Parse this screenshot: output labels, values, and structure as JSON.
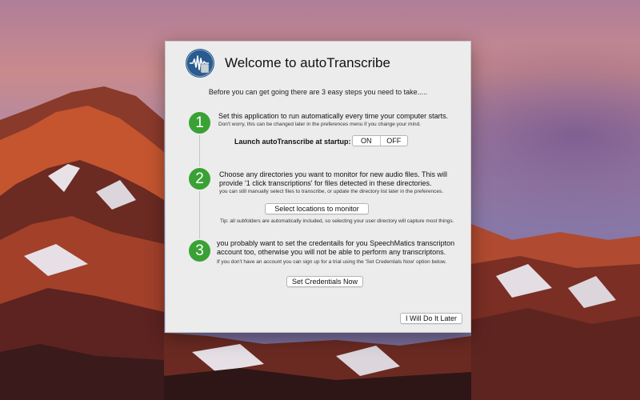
{
  "dialog": {
    "title": "Welcome to autoTranscribe",
    "intro": "Before you can get going there are 3 easy steps you need to take.....",
    "app_icon": "waveform-app-icon"
  },
  "steps": [
    {
      "number": "1",
      "main": "Set this application to run automatically every time your computer starts.",
      "sub": "Don't worry, this can be changed later in the preferences menu if you change your mind."
    },
    {
      "number": "2",
      "main_line1": "Choose any directories you want to monitor for new audio files.  This will",
      "main_line2": "provide '1 click transcriptions' for files detected in these directories.",
      "sub": "you can still manually select files to transcribe, or update the directory list later in the preferences."
    },
    {
      "number": "3",
      "main_line1": "you probably want to set the credentails for you SpeechMatics transcripton",
      "main_line2": "account too, otherwise you will not be able to perform any transcriptons.",
      "sub": "If you don't have an account you can sign up for a trial using the 'Set Credentials Now' option below."
    }
  ],
  "startup": {
    "label": "Launch autoTranscribe at startup:",
    "on": "ON",
    "off": "OFF"
  },
  "buttons": {
    "select_locations": "Select locations to monitor",
    "set_credentials": "Set Credentials Now",
    "later": "I Will Do It Later"
  },
  "tip": "Tip: all subfolders are automatically included, so selecting your user directory will capture most things.",
  "colors": {
    "step_badge": "#3aa135",
    "app_icon_bg": "#2a5a8e"
  }
}
